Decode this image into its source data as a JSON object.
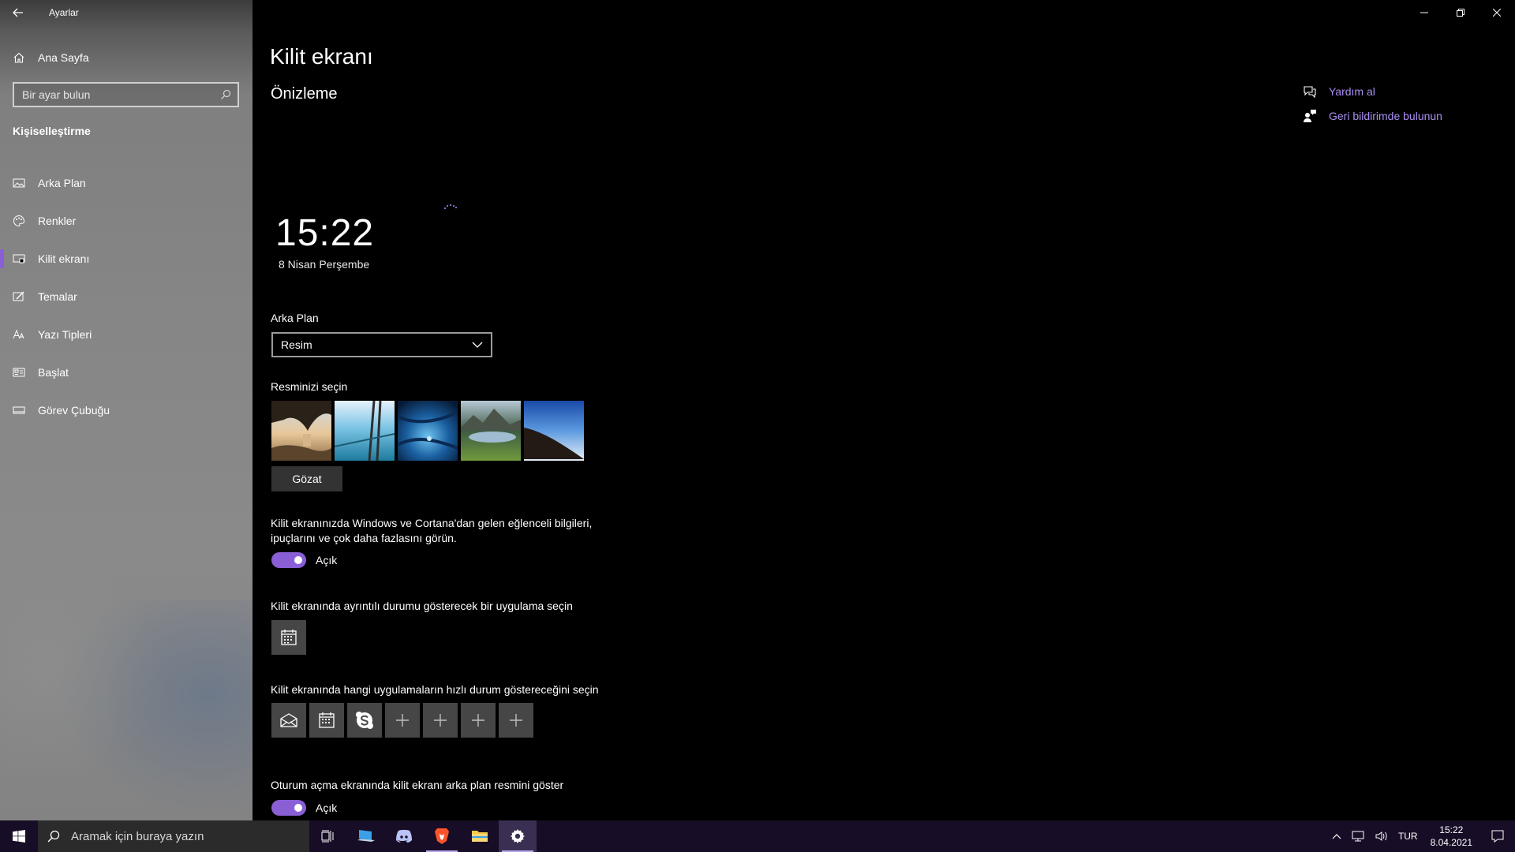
{
  "window": {
    "title": "Ayarlar"
  },
  "sidebar": {
    "home_label": "Ana Sayfa",
    "search_placeholder": "Bir ayar bulun",
    "section_title": "Kişiselleştirme",
    "items": [
      {
        "label": "Arka Plan",
        "icon": "picture-icon",
        "active": false
      },
      {
        "label": "Renkler",
        "icon": "palette-icon",
        "active": false
      },
      {
        "label": "Kilit ekranı",
        "icon": "lock-screen-icon",
        "active": true
      },
      {
        "label": "Temalar",
        "icon": "brush-icon",
        "active": false
      },
      {
        "label": "Yazı Tipleri",
        "icon": "font-icon",
        "active": false
      },
      {
        "label": "Başlat",
        "icon": "start-icon",
        "active": false
      },
      {
        "label": "Görev Çubuğu",
        "icon": "taskbar-icon",
        "active": false
      }
    ]
  },
  "main": {
    "page_title": "Kilit ekranı",
    "preview_heading": "Önizleme",
    "preview_time": "15:22",
    "preview_date": "8 Nisan Perşembe",
    "background_label": "Arka Plan",
    "background_value": "Resim",
    "choose_picture_label": "Resminizi seçin",
    "browse_label": "Gözat",
    "fun_facts_desc": "Kilit ekranınızda Windows ve Cortana'dan gelen eğlenceli bilgileri, ipuçlarını ve çok daha fazlasını görün.",
    "fun_facts_state": "Açık",
    "detailed_status_label": "Kilit ekranında ayrıntılı durumu gösterecek bir uygulama seçin",
    "quick_status_label": "Kilit ekranında hangi uygulamaların hızlı durum göstereceğini seçin",
    "signin_bg_label": "Oturum açma ekranında kilit ekranı arka plan resmini göster",
    "signin_bg_state": "Açık",
    "help_link": "Yardım al",
    "feedback_link": "Geri bildirimde bulunun"
  },
  "taskbar": {
    "search_placeholder": "Aramak için buraya yazın",
    "language": "TUR",
    "time": "15:22",
    "date": "8.04.2021"
  },
  "colors": {
    "accent": "#8a5fd6",
    "link": "#a98ef0",
    "taskbar": "#180d26"
  }
}
